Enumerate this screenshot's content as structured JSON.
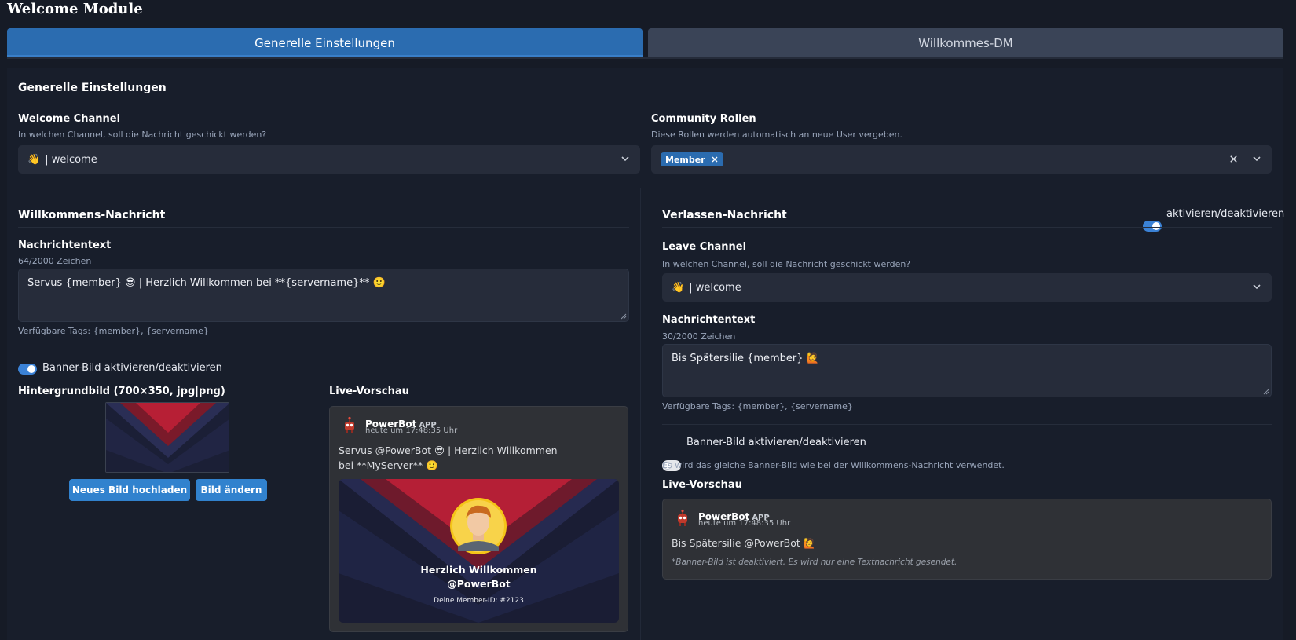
{
  "page": {
    "title": "Welcome Module"
  },
  "tabs": [
    {
      "label": "Generelle Einstellungen",
      "active": true
    },
    {
      "label": "Willkommes-DM",
      "active": false
    }
  ],
  "general": {
    "heading": "Generelle Einstellungen",
    "welcome_channel": {
      "label": "Welcome Channel",
      "description": "In welchen Channel, soll die Nachricht geschickt werden?",
      "value_emoji": "👋",
      "value": "| welcome"
    },
    "community_roles": {
      "label": "Community Rollen",
      "description": "Diese Rollen werden automatisch an neue User vergeben.",
      "chips": [
        "Member"
      ]
    }
  },
  "welcome": {
    "heading": "Willkommens-Nachricht",
    "message_label": "Nachrichtentext",
    "char_count": "64/2000 Zeichen",
    "message_text": "Servus {member} 😎 | Herzlich Willkommen bei **{servername}** 🙂",
    "tags_hint": "Verfügbare Tags: {member}, {servername}",
    "banner_toggle_label": "Banner-Bild aktivieren/deaktivieren",
    "banner_enabled": true,
    "bg_label": "Hintergrundbild (700×350, jpg|png)",
    "upload_button": "Neues Bild hochladen",
    "change_button": "Bild ändern",
    "preview_label": "Live-Vorschau",
    "preview": {
      "bot_name": "PowerBot",
      "app_tag": "APP",
      "time": "heute um 17:48:35 Uhr",
      "message": "Servus @PowerBot 😎 | Herzlich Willkommen bei **MyServer** 🙂",
      "banner_title": "Herzlich Willkommen",
      "banner_user": "@PowerBot",
      "banner_member_id": "Deine Member-ID: #2123"
    }
  },
  "leave": {
    "heading": "Verlassen-Nachricht",
    "toggle_label": "aktivieren/deaktivieren",
    "enabled": true,
    "channel_label": "Leave Channel",
    "channel_description": "In welchen Channel, soll die Nachricht geschickt werden?",
    "channel_emoji": "👋",
    "channel_value": "| welcome",
    "message_label": "Nachrichtentext",
    "char_count": "30/2000 Zeichen",
    "message_text": "Bis Spätersilie {member} 🙋",
    "tags_hint": "Verfügbare Tags: {member}, {servername}",
    "banner_toggle_label": "Banner-Bild aktivieren/deaktivieren",
    "banner_enabled": false,
    "banner_note": "Es wird das gleiche Banner-Bild wie bei der Willkommens-Nachricht verwendet.",
    "preview_label": "Live-Vorschau",
    "preview": {
      "bot_name": "PowerBot",
      "app_tag": "APP",
      "time": "heute um 17:48:35 Uhr",
      "message": "Bis Spätersilie @PowerBot 🙋",
      "note": "*Banner-Bild ist deaktiviert. Es wird nur eine Textnachricht gesendet."
    }
  },
  "colors": {
    "accent": "#2b6cb0",
    "button": "#3182ce",
    "background": "#161b26",
    "panel": "#181e2b",
    "input": "#262c3a"
  }
}
